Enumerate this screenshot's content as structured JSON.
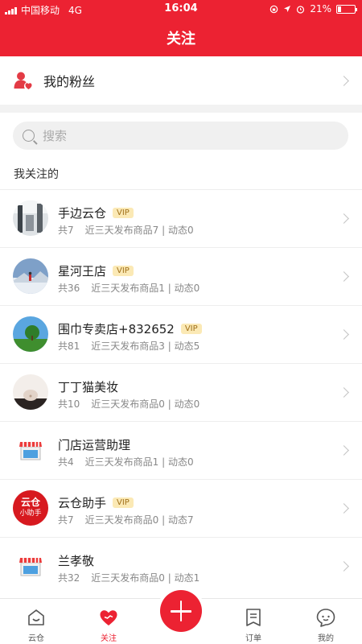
{
  "status_bar": {
    "carrier": "中国移动",
    "network": "4G",
    "time": "16:04",
    "battery": "21%"
  },
  "header": {
    "title": "关注"
  },
  "fans": {
    "label": "我的粉丝"
  },
  "search": {
    "placeholder": "搜索"
  },
  "section": {
    "title": "我关注的"
  },
  "follows": [
    {
      "name": "手边云仓",
      "vip": "VIP",
      "total": "共7",
      "stats": "近三天发布商品7 | 动态0"
    },
    {
      "name": "星河王店",
      "vip": "VIP",
      "total": "共36",
      "stats": "近三天发布商品1 | 动态0"
    },
    {
      "name": "围巾专卖店+832652",
      "vip": "VIP",
      "total": "共81",
      "stats": "近三天发布商品3 | 动态5"
    },
    {
      "name": "丁丁猫美妆",
      "total": "共10",
      "stats": "近三天发布商品0 | 动态0"
    },
    {
      "name": "门店运营助理",
      "total": "共4",
      "stats": "近三天发布商品1 | 动态0"
    },
    {
      "name": "云仓助手",
      "vip": "VIP",
      "total": "共7",
      "stats": "近三天发布商品0 | 动态7"
    },
    {
      "name": "兰孝敬",
      "total": "共32",
      "stats": "近三天发布商品0 | 动态1"
    }
  ],
  "avatar_badge": {
    "line1": "云仓",
    "line2": "小助手"
  },
  "tabs": [
    {
      "label": "云仓",
      "icon": "house-icon"
    },
    {
      "label": "关注",
      "icon": "heart-icon"
    },
    {
      "label": "订单",
      "icon": "order-bookmark-icon"
    },
    {
      "label": "我的",
      "icon": "chat-face-icon"
    }
  ],
  "colors": {
    "brand": "#ec2232",
    "vip_bg": "#fbe9b5",
    "vip_text": "#a0701a"
  }
}
